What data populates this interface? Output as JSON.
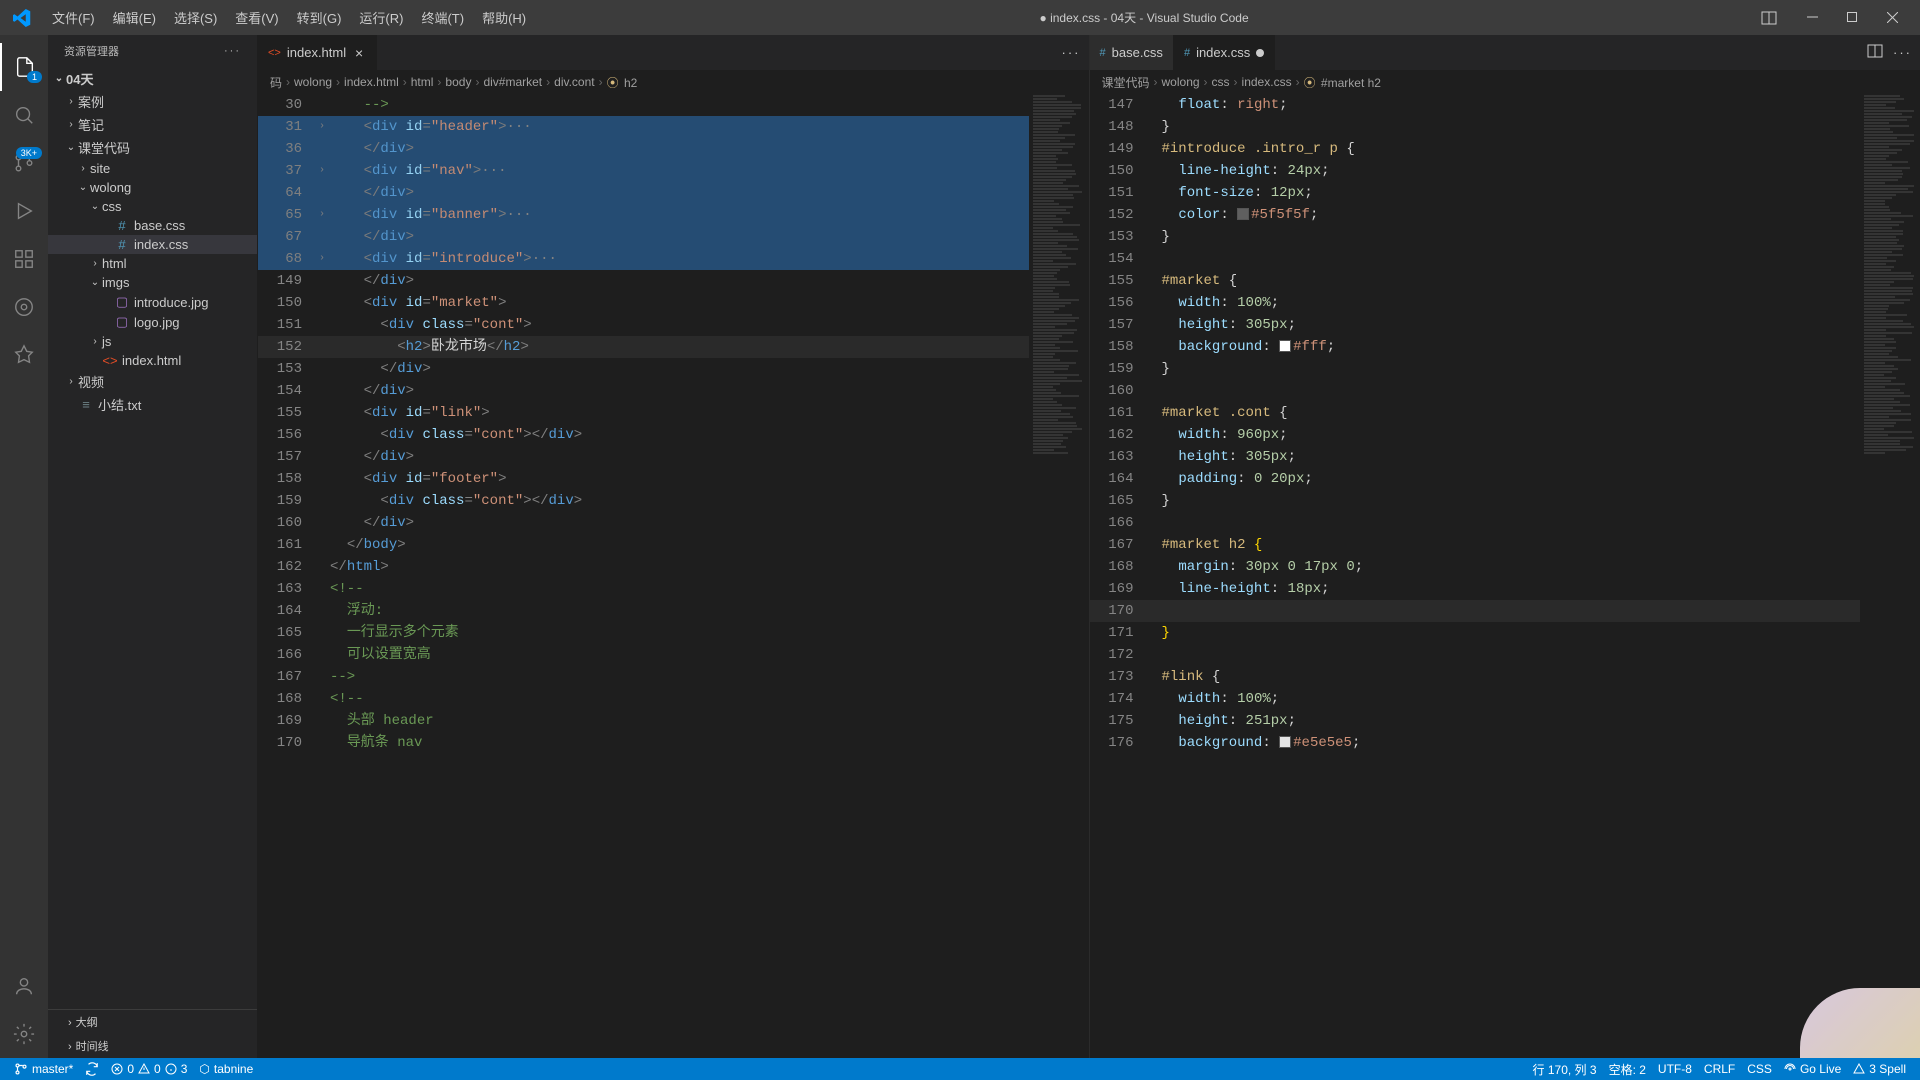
{
  "titlebar": {
    "menus": [
      "文件(F)",
      "编辑(E)",
      "选择(S)",
      "查看(V)",
      "转到(G)",
      "运行(R)",
      "终端(T)",
      "帮助(H)"
    ],
    "title": "● index.css - 04天 - Visual Studio Code"
  },
  "sidebar": {
    "header": "资源管理器",
    "root": "04天",
    "tree": [
      {
        "label": "案例",
        "type": "folder",
        "indent": 1,
        "open": false
      },
      {
        "label": "笔记",
        "type": "folder",
        "indent": 1,
        "open": false
      },
      {
        "label": "课堂代码",
        "type": "folder",
        "indent": 1,
        "open": true
      },
      {
        "label": "site",
        "type": "folder",
        "indent": 2,
        "open": false
      },
      {
        "label": "wolong",
        "type": "folder",
        "indent": 2,
        "open": true
      },
      {
        "label": "css",
        "type": "folder",
        "indent": 3,
        "open": true
      },
      {
        "label": "base.css",
        "type": "css",
        "indent": 4
      },
      {
        "label": "index.css",
        "type": "css",
        "indent": 4,
        "active": true
      },
      {
        "label": "html",
        "type": "folder",
        "indent": 3,
        "open": false
      },
      {
        "label": "imgs",
        "type": "folder",
        "indent": 3,
        "open": true
      },
      {
        "label": "introduce.jpg",
        "type": "img",
        "indent": 4
      },
      {
        "label": "logo.jpg",
        "type": "img",
        "indent": 4
      },
      {
        "label": "js",
        "type": "folder",
        "indent": 3,
        "open": false
      },
      {
        "label": "index.html",
        "type": "html",
        "indent": 3
      },
      {
        "label": "视频",
        "type": "folder",
        "indent": 1,
        "open": false
      },
      {
        "label": "小结.txt",
        "type": "txt",
        "indent": 1
      }
    ],
    "bottom": [
      "大纲",
      "时间线"
    ]
  },
  "left_editor": {
    "tabs": [
      {
        "label": "index.html",
        "icon": "html",
        "active": true,
        "dirty": false
      }
    ],
    "breadcrumb": [
      "码",
      "wolong",
      "index.html",
      "html",
      "body",
      "div#market",
      "div.cont",
      "h2"
    ],
    "lines": [
      {
        "n": 30,
        "html": "<span class='tok-comment'>--&gt;</span>"
      },
      {
        "n": 31,
        "fold": true,
        "hl": true,
        "html": "<span class='tok-punct'>&lt;</span><span class='tok-tag'>div</span> <span class='tok-attr'>id</span><span class='tok-punct'>=</span><span class='tok-str'>\"header\"</span><span class='tok-punct'>&gt;</span><span class='folded-dots'>···</span>"
      },
      {
        "n": 36,
        "hl": true,
        "html": "<span class='tok-punct'>&lt;/</span><span class='tok-tag'>div</span><span class='tok-punct'>&gt;</span>"
      },
      {
        "n": 37,
        "fold": true,
        "hl": true,
        "html": "<span class='tok-punct'>&lt;</span><span class='tok-tag'>div</span> <span class='tok-attr'>id</span><span class='tok-punct'>=</span><span class='tok-str'>\"nav\"</span><span class='tok-punct'>&gt;</span><span class='folded-dots'>···</span>"
      },
      {
        "n": 64,
        "hl": true,
        "html": "<span class='tok-punct'>&lt;/</span><span class='tok-tag'>div</span><span class='tok-punct'>&gt;</span>"
      },
      {
        "n": 65,
        "fold": true,
        "hl": true,
        "html": "<span class='tok-punct'>&lt;</span><span class='tok-tag'>div</span> <span class='tok-attr'>id</span><span class='tok-punct'>=</span><span class='tok-str'>\"banner\"</span><span class='tok-punct'>&gt;</span><span class='folded-dots'>···</span>"
      },
      {
        "n": 67,
        "hl": true,
        "html": "<span class='tok-punct'>&lt;/</span><span class='tok-tag'>div</span><span class='tok-punct'>&gt;</span>"
      },
      {
        "n": 68,
        "fold": true,
        "hl": true,
        "html": "<span class='tok-punct'>&lt;</span><span class='tok-tag'>div</span> <span class='tok-attr'>id</span><span class='tok-punct'>=</span><span class='tok-str'>\"introduce\"</span><span class='tok-punct'>&gt;</span><span class='folded-dots'>···</span>"
      },
      {
        "n": 149,
        "html": "<span class='tok-punct'>&lt;/</span><span class='tok-tag'>div</span><span class='tok-punct'>&gt;</span>"
      },
      {
        "n": 150,
        "html": "<span class='tok-punct'>&lt;</span><span class='tok-tag'>div</span> <span class='tok-attr'>id</span><span class='tok-punct'>=</span><span class='tok-str'>\"market\"</span><span class='tok-punct'>&gt;</span>"
      },
      {
        "n": 151,
        "indent": 1,
        "html": "<span class='tok-punct'>&lt;</span><span class='tok-tag'>div</span> <span class='tok-attr'>class</span><span class='tok-punct'>=</span><span class='tok-str'>\"cont\"</span><span class='tok-punct'>&gt;</span>"
      },
      {
        "n": 152,
        "indent": 2,
        "active": true,
        "html": "<span class='tok-punct'>&lt;</span><span class='tok-tag'>h2</span><span class='tok-punct'>&gt;</span><span class='tok-text'>卧龙市场</span><span class='tok-punct'>&lt;/</span><span class='tok-tag'>h2</span><span class='tok-punct'>&gt;</span>"
      },
      {
        "n": 153,
        "indent": 1,
        "html": "<span class='tok-punct'>&lt;/</span><span class='tok-tag'>div</span><span class='tok-punct'>&gt;</span>"
      },
      {
        "n": 154,
        "html": "<span class='tok-punct'>&lt;/</span><span class='tok-tag'>div</span><span class='tok-punct'>&gt;</span>"
      },
      {
        "n": 155,
        "html": "<span class='tok-punct'>&lt;</span><span class='tok-tag'>div</span> <span class='tok-attr'>id</span><span class='tok-punct'>=</span><span class='tok-str'>\"link\"</span><span class='tok-punct'>&gt;</span>"
      },
      {
        "n": 156,
        "indent": 1,
        "html": "<span class='tok-punct'>&lt;</span><span class='tok-tag'>div</span> <span class='tok-attr'>class</span><span class='tok-punct'>=</span><span class='tok-str'>\"cont\"</span><span class='tok-punct'>&gt;&lt;/</span><span class='tok-tag'>div</span><span class='tok-punct'>&gt;</span>"
      },
      {
        "n": 157,
        "html": "<span class='tok-punct'>&lt;/</span><span class='tok-tag'>div</span><span class='tok-punct'>&gt;</span>"
      },
      {
        "n": 158,
        "html": "<span class='tok-punct'>&lt;</span><span class='tok-tag'>div</span> <span class='tok-attr'>id</span><span class='tok-punct'>=</span><span class='tok-str'>\"footer\"</span><span class='tok-punct'>&gt;</span>"
      },
      {
        "n": 159,
        "indent": 1,
        "html": "<span class='tok-punct'>&lt;</span><span class='tok-tag'>div</span> <span class='tok-attr'>class</span><span class='tok-punct'>=</span><span class='tok-str'>\"cont\"</span><span class='tok-punct'>&gt;&lt;/</span><span class='tok-tag'>div</span><span class='tok-punct'>&gt;</span>"
      },
      {
        "n": 160,
        "html": "<span class='tok-punct'>&lt;/</span><span class='tok-tag'>div</span><span class='tok-punct'>&gt;</span>"
      },
      {
        "n": 161,
        "base": -1,
        "html": "<span class='tok-punct'>&lt;/</span><span class='tok-tag'>body</span><span class='tok-punct'>&gt;</span>"
      },
      {
        "n": 162,
        "base": -2,
        "html": "<span class='tok-punct'>&lt;/</span><span class='tok-tag'>html</span><span class='tok-punct'>&gt;</span>"
      },
      {
        "n": 163,
        "base": -2,
        "html": "<span class='tok-comment'>&lt;!--</span>"
      },
      {
        "n": 164,
        "base": -1,
        "html": "<span class='tok-comment'>浮动:</span>"
      },
      {
        "n": 165,
        "base": -1,
        "html": "<span class='tok-comment'>一行显示多个元素</span>"
      },
      {
        "n": 166,
        "base": -1,
        "html": "<span class='tok-comment'>可以设置宽高</span>"
      },
      {
        "n": 167,
        "base": -2,
        "html": "<span class='tok-comment'>--&gt;</span>"
      },
      {
        "n": 168,
        "base": -2,
        "html": "<span class='tok-comment'>&lt;!--</span>"
      },
      {
        "n": 169,
        "base": -1,
        "html": "<span class='tok-comment'>头部 header</span>"
      },
      {
        "n": 170,
        "base": -1,
        "html": "<span class='tok-comment'>导航条 nav</span>"
      }
    ]
  },
  "right_editor": {
    "tabs": [
      {
        "label": "base.css",
        "icon": "css",
        "active": false
      },
      {
        "label": "index.css",
        "icon": "css",
        "active": true,
        "dirty": true
      }
    ],
    "breadcrumb": [
      "课堂代码",
      "wolong",
      "css",
      "index.css",
      "#market h2"
    ],
    "lines": [
      {
        "n": 147,
        "indent": 1,
        "html": "<span class='tok-prop'>float</span><span class='tok-text'>:</span> <span class='tok-val'>right</span><span class='tok-text'>;</span>"
      },
      {
        "n": 148,
        "html": "<span class='tok-text'>}</span>"
      },
      {
        "n": 149,
        "html": "<span class='tok-sel'>#introduce .intro_r p</span> <span class='tok-text'>{</span>"
      },
      {
        "n": 150,
        "indent": 1,
        "html": "<span class='tok-prop'>line-height</span><span class='tok-text'>:</span> <span class='tok-num'>24px</span><span class='tok-text'>;</span>"
      },
      {
        "n": 151,
        "indent": 1,
        "html": "<span class='tok-prop'>font-size</span><span class='tok-text'>:</span> <span class='tok-num'>12px</span><span class='tok-text'>;</span>"
      },
      {
        "n": 152,
        "indent": 1,
        "html": "<span class='tok-prop'>color</span><span class='tok-text'>:</span> <span class='color-swatch' style='background:#5f5f5f'></span><span class='tok-val'>#5f5f5f</span><span class='tok-text'>;</span>"
      },
      {
        "n": 153,
        "html": "<span class='tok-text'>}</span>"
      },
      {
        "n": 154,
        "html": ""
      },
      {
        "n": 155,
        "html": "<span class='tok-sel'>#market</span> <span class='tok-text'>{</span>"
      },
      {
        "n": 156,
        "indent": 1,
        "html": "<span class='tok-prop'>width</span><span class='tok-text'>:</span> <span class='tok-num'>100%</span><span class='tok-text'>;</span>"
      },
      {
        "n": 157,
        "indent": 1,
        "html": "<span class='tok-prop'>height</span><span class='tok-text'>:</span> <span class='tok-num'>305px</span><span class='tok-text'>;</span>"
      },
      {
        "n": 158,
        "indent": 1,
        "html": "<span class='tok-prop'>background</span><span class='tok-text'>:</span> <span class='color-swatch' style='background:#fff'></span><span class='tok-val'>#fff</span><span class='tok-text'>;</span>"
      },
      {
        "n": 159,
        "html": "<span class='tok-text'>}</span>"
      },
      {
        "n": 160,
        "html": ""
      },
      {
        "n": 161,
        "html": "<span class='tok-sel'>#market .cont</span> <span class='tok-text'>{</span>"
      },
      {
        "n": 162,
        "indent": 1,
        "html": "<span class='tok-prop'>width</span><span class='tok-text'>:</span> <span class='tok-num'>960px</span><span class='tok-text'>;</span>"
      },
      {
        "n": 163,
        "indent": 1,
        "html": "<span class='tok-prop'>height</span><span class='tok-text'>:</span> <span class='tok-num'>305px</span><span class='tok-text'>;</span>"
      },
      {
        "n": 164,
        "indent": 1,
        "html": "<span class='tok-prop'>padding</span><span class='tok-text'>:</span> <span class='tok-num'>0 20px</span><span class='tok-text'>;</span>"
      },
      {
        "n": 165,
        "html": "<span class='tok-text'>}</span>"
      },
      {
        "n": 166,
        "html": ""
      },
      {
        "n": 167,
        "html": "<span class='tok-sel'>#market h2</span> <span class='tok-brace'>{</span>"
      },
      {
        "n": 168,
        "indent": 1,
        "html": "<span class='tok-prop'>margin</span><span class='tok-text'>:</span> <span class='tok-num'>30px 0 17px 0</span><span class='tok-text'>;</span>"
      },
      {
        "n": 169,
        "indent": 1,
        "html": "<span class='tok-prop'>line-height</span><span class='tok-text'>:</span> <span class='tok-num'>18px</span><span class='tok-text'>;</span>"
      },
      {
        "n": 170,
        "indent": 1,
        "active": true,
        "html": ""
      },
      {
        "n": 171,
        "html": "<span class='tok-brace'>}</span>"
      },
      {
        "n": 172,
        "html": ""
      },
      {
        "n": 173,
        "html": "<span class='tok-sel'>#link</span> <span class='tok-text'>{</span>"
      },
      {
        "n": 174,
        "indent": 1,
        "html": "<span class='tok-prop'>width</span><span class='tok-text'>:</span> <span class='tok-num'>100%</span><span class='tok-text'>;</span>"
      },
      {
        "n": 175,
        "indent": 1,
        "html": "<span class='tok-prop'>height</span><span class='tok-text'>:</span> <span class='tok-num'>251px</span><span class='tok-text'>;</span>"
      },
      {
        "n": 176,
        "indent": 1,
        "html": "<span class='tok-prop'>background</span><span class='tok-text'>:</span> <span class='color-swatch' style='background:#e5e5e5'></span><span class='tok-val'>#e5e5e5</span><span class='tok-text'>;</span>"
      }
    ]
  },
  "status": {
    "branch": "master*",
    "errors": "0",
    "warnings": "0",
    "info": "3",
    "tabnine": "tabnine",
    "cursor": "行 170, 列 3",
    "spaces": "空格: 2",
    "encoding": "UTF-8",
    "eol": "CRLF",
    "lang": "CSS",
    "golive": "Go Live",
    "spell": "3 Spell"
  },
  "activity_badge": "3K+"
}
